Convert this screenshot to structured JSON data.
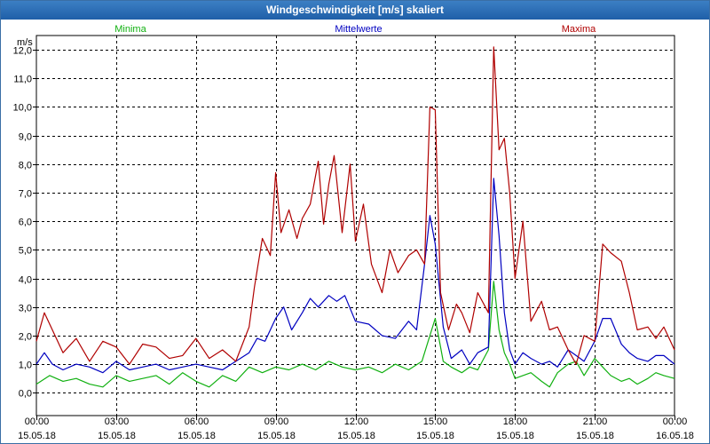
{
  "window": {
    "title": "Windgeschwindigkeit [m/s] skaliert"
  },
  "chart_data": {
    "type": "line",
    "ylabel": "m/s",
    "ylim": [
      -0.8,
      12.5
    ],
    "y_ticks": [
      "0,0",
      "1,0",
      "2,0",
      "3,0",
      "4,0",
      "5,0",
      "6,0",
      "7,0",
      "8,0",
      "9,0",
      "10,0",
      "11,0",
      "12,0"
    ],
    "xlim": [
      0,
      24
    ],
    "x_ticks": [
      {
        "time": "00:00",
        "date": "15.05.18"
      },
      {
        "time": "03:00",
        "date": "15.05.18"
      },
      {
        "time": "06:00",
        "date": "15.05.18"
      },
      {
        "time": "09:00",
        "date": "15.05.18"
      },
      {
        "time": "12:00",
        "date": "15.05.18"
      },
      {
        "time": "15:00",
        "date": "15.05.18"
      },
      {
        "time": "18:00",
        "date": "15.05.18"
      },
      {
        "time": "21:00",
        "date": "15.05.18"
      },
      {
        "time": "00:00",
        "date": "16.05.18"
      }
    ],
    "grid": true,
    "legend_position": "top",
    "series": [
      {
        "name": "Minima",
        "color": "#10b010",
        "x": [
          0,
          0.5,
          1,
          1.5,
          2,
          2.5,
          3,
          3.5,
          4,
          4.5,
          5,
          5.5,
          6,
          6.5,
          7,
          7.5,
          8,
          8.5,
          9,
          9.5,
          10,
          10.5,
          11,
          11.5,
          12,
          12.5,
          13,
          13.5,
          14,
          14.5,
          14.8,
          15,
          15.3,
          15.6,
          16,
          16.3,
          16.6,
          17,
          17.2,
          17.4,
          17.6,
          17.8,
          18,
          18.3,
          18.6,
          19,
          19.3,
          19.6,
          20,
          20.3,
          20.6,
          21,
          21.3,
          21.6,
          22,
          22.3,
          22.6,
          23,
          23.3,
          23.6,
          24
        ],
        "values": [
          0.3,
          0.6,
          0.4,
          0.5,
          0.3,
          0.2,
          0.6,
          0.4,
          0.5,
          0.6,
          0.3,
          0.7,
          0.4,
          0.2,
          0.6,
          0.4,
          0.9,
          0.7,
          0.9,
          0.8,
          1.0,
          0.8,
          1.1,
          0.9,
          0.8,
          0.9,
          0.7,
          1.0,
          0.8,
          1.1,
          2.0,
          2.6,
          1.1,
          0.9,
          0.7,
          0.9,
          0.8,
          1.5,
          3.9,
          2.2,
          1.4,
          1.0,
          0.5,
          0.6,
          0.7,
          0.4,
          0.2,
          0.7,
          1.0,
          1.1,
          0.6,
          1.2,
          0.9,
          0.6,
          0.4,
          0.5,
          0.3,
          0.5,
          0.7,
          0.6,
          0.5
        ]
      },
      {
        "name": "Mittelwerte",
        "color": "#0000c0",
        "x": [
          0,
          0.3,
          0.6,
          1,
          1.5,
          2,
          2.5,
          3,
          3.5,
          4,
          4.5,
          5,
          5.5,
          6,
          6.5,
          7,
          7.5,
          8,
          8.3,
          8.6,
          9,
          9.3,
          9.6,
          10,
          10.3,
          10.6,
          11,
          11.3,
          11.6,
          12,
          12.5,
          13,
          13.5,
          14,
          14.3,
          14.6,
          14.8,
          15,
          15.3,
          15.6,
          16,
          16.3,
          16.6,
          17,
          17.2,
          17.4,
          17.6,
          17.8,
          18,
          18.3,
          18.6,
          19,
          19.3,
          19.6,
          20,
          20.3,
          20.6,
          21,
          21.3,
          21.6,
          22,
          22.3,
          22.6,
          23,
          23.3,
          23.6,
          24
        ],
        "values": [
          1.0,
          1.4,
          1.0,
          0.8,
          1.0,
          0.9,
          0.7,
          1.1,
          0.8,
          0.9,
          1.0,
          0.8,
          0.9,
          1.0,
          0.9,
          0.8,
          1.1,
          1.4,
          1.9,
          1.8,
          2.6,
          3.0,
          2.2,
          2.8,
          3.3,
          3.0,
          3.4,
          3.2,
          3.4,
          2.5,
          2.4,
          2.0,
          1.9,
          2.5,
          2.2,
          4.5,
          6.2,
          5.2,
          2.3,
          1.2,
          1.5,
          1.0,
          1.4,
          1.6,
          7.5,
          5.5,
          2.8,
          1.5,
          1.0,
          1.4,
          1.2,
          1.0,
          1.1,
          0.9,
          1.5,
          1.3,
          1.1,
          1.8,
          2.6,
          2.6,
          1.7,
          1.4,
          1.2,
          1.1,
          1.3,
          1.3,
          1.0
        ]
      },
      {
        "name": "Maxima",
        "color": "#b00000",
        "x": [
          0,
          0.3,
          0.6,
          1,
          1.5,
          2,
          2.5,
          3,
          3.5,
          4,
          4.5,
          5,
          5.5,
          6,
          6.5,
          7,
          7.5,
          8,
          8.2,
          8.5,
          8.8,
          9,
          9.2,
          9.5,
          9.8,
          10,
          10.3,
          10.6,
          10.8,
          11,
          11.2,
          11.5,
          11.8,
          12,
          12.3,
          12.6,
          13,
          13.3,
          13.6,
          14,
          14.3,
          14.6,
          14.8,
          15,
          15.2,
          15.5,
          15.8,
          16,
          16.3,
          16.6,
          17,
          17.2,
          17.4,
          17.6,
          17.8,
          18,
          18.3,
          18.6,
          19,
          19.3,
          19.6,
          20,
          20.3,
          20.6,
          21,
          21.3,
          21.6,
          22,
          22.3,
          22.6,
          23,
          23.3,
          23.6,
          24
        ],
        "values": [
          1.8,
          2.8,
          2.2,
          1.4,
          1.9,
          1.1,
          1.8,
          1.6,
          1.0,
          1.7,
          1.6,
          1.2,
          1.3,
          1.9,
          1.2,
          1.5,
          1.1,
          2.3,
          3.7,
          5.4,
          4.8,
          7.7,
          5.6,
          6.4,
          5.4,
          6.1,
          6.6,
          8.1,
          5.9,
          7.3,
          8.3,
          5.6,
          8.0,
          5.3,
          6.6,
          4.5,
          3.5,
          5.0,
          4.2,
          4.8,
          5.0,
          4.5,
          10.0,
          9.9,
          3.5,
          2.2,
          3.1,
          2.8,
          2.1,
          3.5,
          2.8,
          12.1,
          8.5,
          8.9,
          7.0,
          4.0,
          6.0,
          2.5,
          3.2,
          2.2,
          2.3,
          1.5,
          1.0,
          2.0,
          1.8,
          5.2,
          4.9,
          4.6,
          3.5,
          2.2,
          2.3,
          1.9,
          2.3,
          1.5
        ]
      }
    ]
  }
}
